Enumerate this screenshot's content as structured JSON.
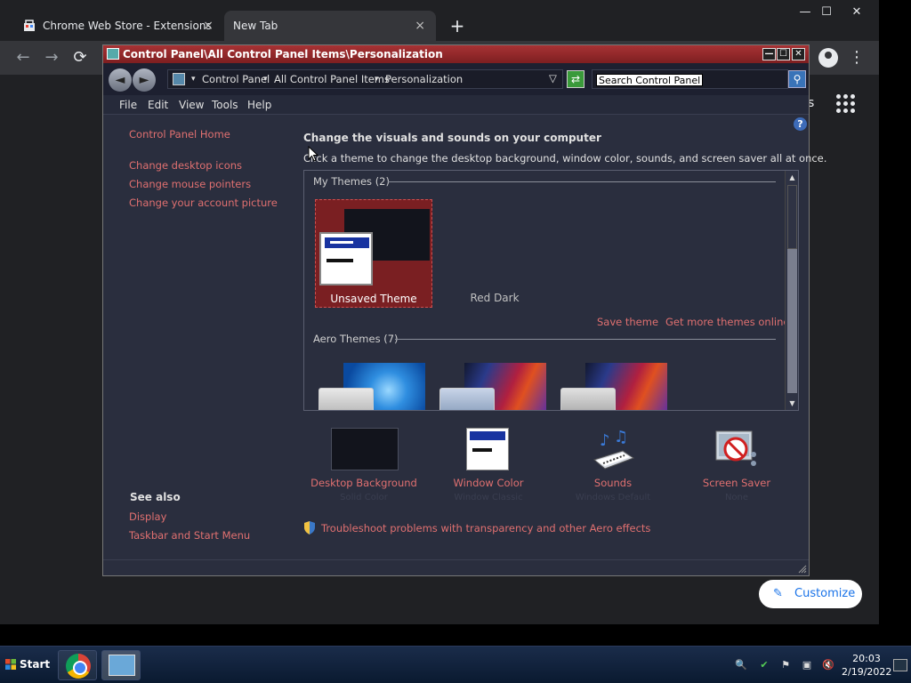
{
  "chrome": {
    "tabs": [
      {
        "title": "Chrome Web Store - Extensions",
        "close": "×"
      },
      {
        "title": "New Tab",
        "close": "×"
      }
    ],
    "new_tab": "+",
    "window_controls": {
      "minimize": "—",
      "maximize": "☐",
      "close": "✕"
    },
    "nav": {
      "back": "←",
      "forward": "→",
      "reload": "⟳"
    },
    "menu": "⋮",
    "ntp_fragment": "s",
    "customize_label": "Customize",
    "customize_icon": "✎"
  },
  "cp": {
    "title": "Control Panel\\All Control Panel Items\\Personalization",
    "title_buttons": {
      "minimize": "—",
      "maximize": "☐",
      "close": "✕"
    },
    "back_glyph": "◄",
    "forward_glyph": "►",
    "breadcrumb": [
      "Control Panel",
      "All Control Panel Items",
      "Personalization"
    ],
    "breadcrumb_sep": "▾",
    "address_dropdown": "▽",
    "refresh_glyph": "⇄",
    "search_placeholder": "Search Control Panel",
    "search_glyph": "⚲",
    "menu": [
      "File",
      "Edit",
      "View",
      "Tools",
      "Help"
    ],
    "help_glyph": "?",
    "sidebar": {
      "home": "Control Panel Home",
      "links": [
        "Change desktop icons",
        "Change mouse pointers",
        "Change your account picture"
      ],
      "see_also_title": "See also",
      "see_also": [
        "Display",
        "Taskbar and Start Menu"
      ]
    },
    "heading": "Change the visuals and sounds on your computer",
    "subtext": "Click a theme to change the desktop background, window color, sounds, and screen saver all at once.",
    "my_themes_label": "My Themes (2)",
    "themes": [
      {
        "name": "Unsaved Theme",
        "selected": true
      },
      {
        "name": "Red Dark",
        "selected": false
      }
    ],
    "save_theme": "Save theme",
    "more_themes": "Get more themes online",
    "aero_label": "Aero Themes (7)",
    "scroll_up": "▲",
    "scroll_down": "▼",
    "bottom_items": [
      {
        "label": "Desktop Background",
        "sublabel": "Solid Color"
      },
      {
        "label": "Window Color",
        "sublabel": "Window Classic"
      },
      {
        "label": "Sounds",
        "sublabel": "Windows Default"
      },
      {
        "label": "Screen Saver",
        "sublabel": "None"
      }
    ],
    "troubleshoot": "Troubleshoot problems with transparency and other Aero effects"
  },
  "taskbar": {
    "start": "Start",
    "time": "20:03",
    "date": "2/19/2022",
    "tray_icons": [
      "🔍",
      "✔",
      "⚑",
      "▣",
      "🔇"
    ]
  },
  "colors": {
    "accent_red": "#a83234",
    "link": "#e07070",
    "window_bg": "#2a2e3e"
  }
}
